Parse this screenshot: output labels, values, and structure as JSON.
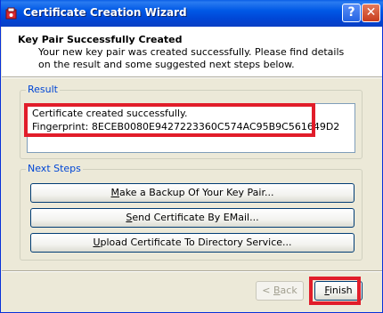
{
  "window": {
    "title": "Certificate Creation Wizard",
    "help_label": "?",
    "close_label": "✕"
  },
  "header": {
    "title": "Key Pair Successfully Created",
    "description": "Your new key pair was created successfully. Please find details on the result and some suggested next steps below."
  },
  "result": {
    "group_label": "Result",
    "line1": "Certificate created successfully.",
    "line2": "Fingerprint: 8ECEB0080E9427223360C574AC95B9C561649D2"
  },
  "next_steps": {
    "group_label": "Next Steps",
    "buttons": [
      {
        "pre": "",
        "accel": "M",
        "post": "ake a Backup Of Your Key Pair..."
      },
      {
        "pre": "",
        "accel": "S",
        "post": "end Certificate By EMail..."
      },
      {
        "pre": "",
        "accel": "U",
        "post": "pload Certificate To Directory Service..."
      }
    ]
  },
  "footer": {
    "back_pre": "< ",
    "back_accel": "B",
    "back_post": "ack",
    "finish_accel": "F",
    "finish_post": "inish"
  },
  "colors": {
    "highlight": "#e11d2a",
    "titlebar": "#0058e6",
    "group_label": "#0046d5"
  }
}
